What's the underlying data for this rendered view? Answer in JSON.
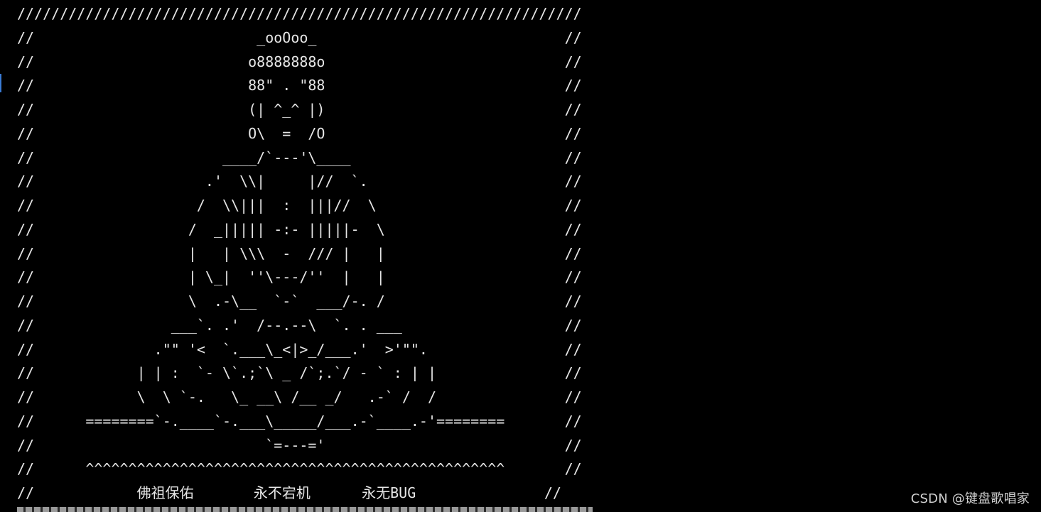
{
  "terminal": {
    "lines": [
      "//////////////////////////////////////////////////////////////////",
      "//                          _ooOoo_                             //",
      "//                         o8888888o                            //",
      "//                         88\" . \"88                            //",
      "//                         (| ^_^ |)                            //",
      "//                         O\\  =  /O                            //",
      "//                      ____/`---'\\____                         //",
      "//                    .'  \\\\|     |//  `.                       //",
      "//                   /  \\\\|||  :  |||//  \\                      //",
      "//                  /  _||||| -:- |||||-  \\                     //",
      "//                  |   | \\\\\\  -  /// |   |                     //",
      "//                  | \\_|  ''\\---/''  |   |                     //",
      "//                  \\  .-\\__  `-`  ___/-. /                     //",
      "//                ___`. .'  /--.--\\  `. . ___                   //",
      "//              .\"\" '<  `.___\\_<|>_/___.'  >'\"\".                //",
      "//            | | :  `- \\`.;`\\ _ /`;.`/ - ` : | |               //",
      "//            \\  \\ `-.   \\_ __\\ /__ _/   .-` /  /               //",
      "//      ========`-.____`-.___\\_____/___.-`____.-'========       //",
      "//                           `=---='                            //",
      "//      ^^^^^^^^^^^^^^^^^^^^^^^^^^^^^^^^^^^^^^^^^^^^^^^^^       //",
      "//            佛祖保佑       永不宕机      永无BUG               //"
    ]
  },
  "watermark": {
    "text": "CSDN @键盘歌唱家"
  },
  "colors": {
    "background": "#000000",
    "text": "#e6e6e6",
    "watermark": "#d0d0d0"
  }
}
